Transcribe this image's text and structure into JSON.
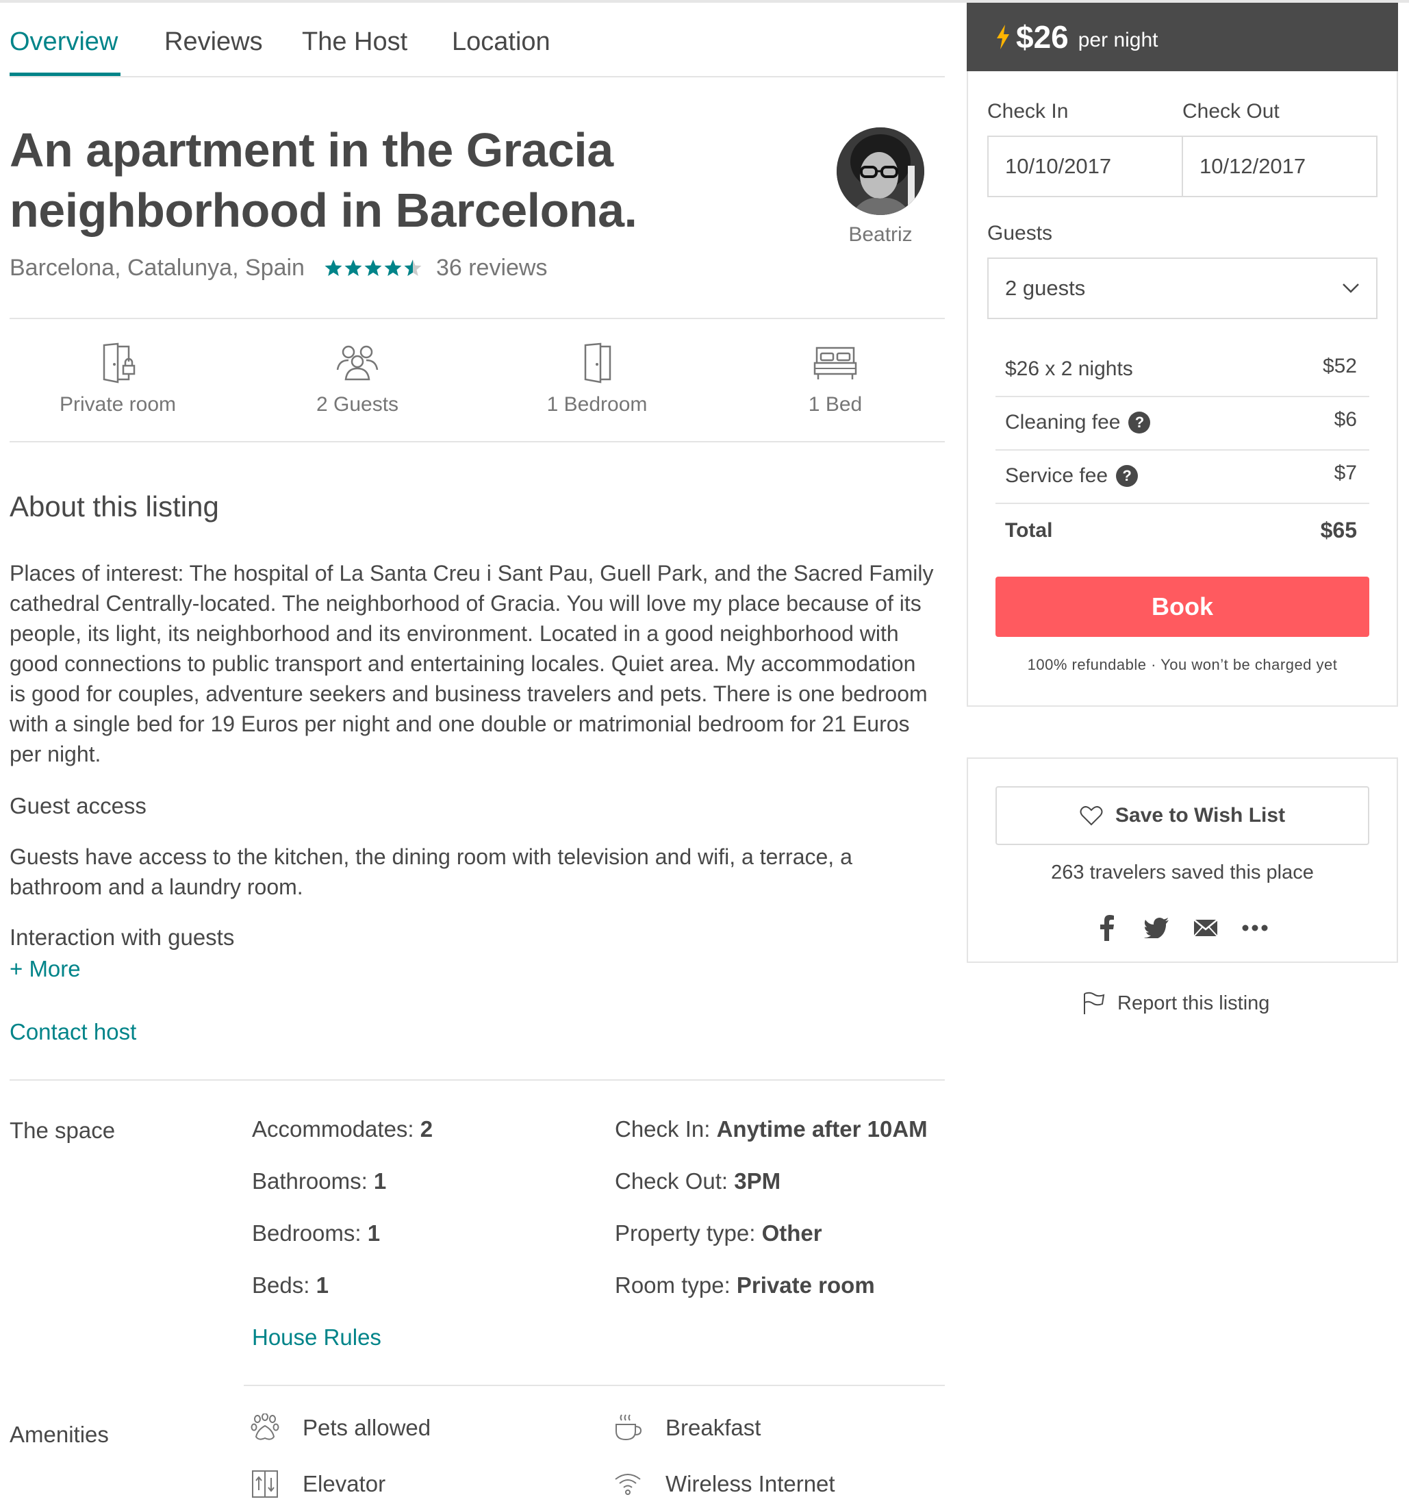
{
  "nav": {
    "tabs": [
      "Overview",
      "Reviews",
      "The Host",
      "Location"
    ]
  },
  "listing": {
    "title": "An apartment in the Gracia neighborhood in Barcelona.",
    "location": "Barcelona, Catalunya, Spain",
    "rating_stars": 4.5,
    "reviews": "36 reviews",
    "host_name": "Beatriz"
  },
  "summary": {
    "items": [
      {
        "label": "Private room",
        "icon": "private-room-icon"
      },
      {
        "label": "2 Guests",
        "icon": "guests-icon"
      },
      {
        "label": "1 Bedroom",
        "icon": "bedroom-door-icon"
      },
      {
        "label": "1 Bed",
        "icon": "bed-icon"
      }
    ]
  },
  "about": {
    "heading": "About this listing",
    "description": "Places of interest: The hospital of La Santa Creu i Sant Pau, Guell Park, and the Sacred Family cathedral Centrally-located. The neighborhood of Gracia. You will love my place because of its people, its light, its neighborhood and its environment. Located in a good neighborhood with good connections to public transport and entertaining locales. Quiet area. My accommodation is good for couples, adventure seekers and business travelers and pets. There is one bedroom with a single bed for 19 Euros per night and one double or matrimonial bedroom for 21 Euros per night.",
    "guest_access_heading": "Guest access",
    "guest_access": "Guests have access to the kitchen, the dining room with television and wifi, a terrace, a bathroom and a laundry room.",
    "interaction_heading": "Interaction with guests",
    "more_link": "+ More",
    "contact_link": "Contact host"
  },
  "space": {
    "heading": "The space",
    "left": [
      {
        "label": "Accommodates: ",
        "value": "2"
      },
      {
        "label": "Bathrooms: ",
        "value": "1"
      },
      {
        "label": "Bedrooms: ",
        "value": "1"
      },
      {
        "label": "Beds: ",
        "value": "1"
      }
    ],
    "right": [
      {
        "label": "Check In: ",
        "value": "Anytime after 10AM"
      },
      {
        "label": "Check Out: ",
        "value": "3PM"
      },
      {
        "label": "Property type: ",
        "value": "Other"
      },
      {
        "label": "Room type: ",
        "value": "Private room"
      }
    ],
    "house_rules_link": "House Rules"
  },
  "amenities": {
    "heading": "Amenities",
    "items": [
      {
        "label": "Pets allowed",
        "icon": "paw-icon"
      },
      {
        "label": "Breakfast",
        "icon": "coffee-cup-icon"
      },
      {
        "label": "Elevator",
        "icon": "elevator-icon"
      },
      {
        "label": "Wireless Internet",
        "icon": "wifi-icon"
      }
    ]
  },
  "booking": {
    "price": "$26",
    "per_night": "per night",
    "check_in_label": "Check In",
    "check_out_label": "Check Out",
    "check_in_value": "10/10/2017",
    "check_out_value": "10/12/2017",
    "guests_label": "Guests",
    "guests_value": "2 guests",
    "fees": [
      {
        "label": "$26 x 2 nights",
        "value": "$52",
        "help": false
      },
      {
        "label": "Cleaning fee",
        "value": "$6",
        "help": true
      },
      {
        "label": "Service fee",
        "value": "$7",
        "help": true
      }
    ],
    "total_label": "Total",
    "total_value": "$65",
    "book_label": "Book",
    "refund_note": "100% refundable · You won’t be charged yet"
  },
  "wishlist": {
    "save_label": "Save to Wish List",
    "saved_count": "263 travelers saved this place",
    "report_label": "Report this listing"
  },
  "colors": {
    "accent": "#008489",
    "book": "#ff5a5f",
    "price_bar": "#4a4a4a",
    "lightning": "#ffb400"
  }
}
